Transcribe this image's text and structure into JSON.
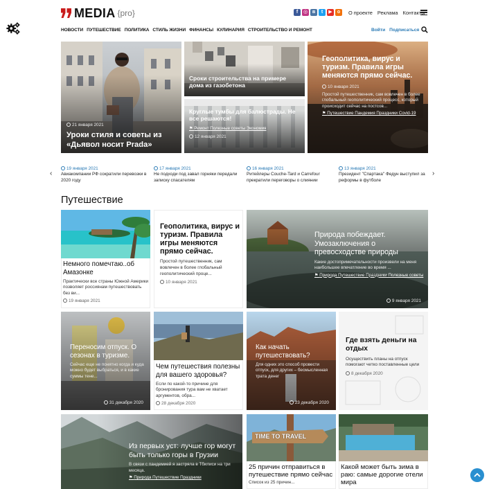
{
  "header": {
    "logo_text": "MEDIA",
    "logo_sub": "{pro}",
    "brand_color": "#c91c1c",
    "links": [
      "О проекте",
      "Реклама",
      "Контакты"
    ],
    "social": [
      {
        "icon": "facebook-icon",
        "glyph": "f",
        "color": "#3b5998"
      },
      {
        "icon": "instagram-icon",
        "glyph": "◎",
        "color": "#c13584"
      },
      {
        "icon": "vk-icon",
        "glyph": "в",
        "color": "#4c75a3"
      },
      {
        "icon": "twitter-icon",
        "glyph": "t",
        "color": "#1da1f2"
      },
      {
        "icon": "youtube-icon",
        "glyph": "▶",
        "color": "#e52d27"
      },
      {
        "icon": "odnoklassniki-icon",
        "glyph": "o",
        "color": "#f2720c"
      }
    ]
  },
  "nav": {
    "items": [
      "НОВОСТИ",
      "ПУТЕШЕСТВИЕ",
      "ПОЛИТИКА",
      "СТИЛЬ ЖИЗНИ",
      "ФИНАНСЫ",
      "КУЛИНАРИЯ",
      "СТРОИТЕЛЬСТВО И РЕМОНТ"
    ],
    "login": "Войти",
    "subscribe": "Подписаться"
  },
  "hero": {
    "main": {
      "date": "21 января 2021",
      "title": "Уроки стиля и советы из «Дьявол носит Prada»"
    },
    "mid_top": {
      "title": "Сроки строительства на примере дома из газобетона"
    },
    "mid_bottom": {
      "title": "Круглые тумбы для балюстрады. Не все решаются!",
      "tags": "Ремонт Полезные советы Экономия",
      "date": "12 января 2021"
    },
    "right": {
      "title": "Геополитика, вирус и туризм. Правила игры меняются прямо сейчас.",
      "date": "10 января 2021",
      "excerpt": "Простой путешественник, сам вовлечен в более глобальный геополитический процесс, который происходит сейчас на постсов...",
      "tags": "Путешествие Пандемия Праздники Covid-19"
    }
  },
  "ticker": [
    {
      "date": "19 января 2021",
      "text": "Авиакомпании РФ сократили перевозки в 2020 году"
    },
    {
      "date": "17 января 2021",
      "text": "Не подходи под завал горняки передали записку спасателям"
    },
    {
      "date": "16 января 2021",
      "text": "Ритейлеры Couche-Tard и Carrefour прекратили переговоры о слиянии"
    },
    {
      "date": "13 января 2021",
      "text": "Президент \"Спартака\" Федун выступил за реформы в футболе"
    }
  ],
  "section_title": "Путешествие",
  "cards": {
    "amazon": {
      "title": "Немного помечтаю..об Амазонке",
      "excerpt": "Практически все страны Южной Америки позволяет россиянам путешествовать без ви...",
      "date": "19 января 2021"
    },
    "geo": {
      "title": "Геополитика, вирус и туризм. Правила игры меняются прямо сейчас.",
      "excerpt": "Простой путешественник, сам вовлечен в более глобальный геополитический проце...",
      "date": "10 января 2021"
    },
    "nature": {
      "title": "Природа побеждает. Умозаключения о превосходстве природы",
      "excerpt": "Какие достопримечательности произвели на меня наибольшее впечатление во время ...",
      "tags": "Природа Путешествие Праздники Полезные советы",
      "date": "9 января 2021"
    },
    "vacation": {
      "title": "Переносим отпуск. О сезонах в туризме.",
      "excerpt": "Сейчас еще не понятно когда и куда можно будет выбраться, и в какие суммы тене...",
      "date": "31 декабря 2020"
    },
    "health": {
      "title": "Чем путешествия полезны для вашего здоровья?",
      "excerpt": "Если по какой-то причине для бронирования тура вам не хватает аргументов, обра...",
      "date": "28 декабря 2020"
    },
    "traveler": {
      "title": "Как начать путешествовать?",
      "excerpt": "Для одних это способ провести отпуск, для других – бесмысленная трата денег",
      "date": "23 декабря 2020"
    },
    "money": {
      "title": "Где взять деньги на отдых",
      "excerpt": "Осуществить планы на отпуск помогают четко поставленные цели",
      "date": "8 декабря 2020"
    },
    "georgia": {
      "title": "Из первых уст: лучше гор могут быть только горы в Грузии",
      "excerpt": "В связи с пандемией я застряла в Тбилиси на три месяца.",
      "tags": "Природа Путешествие Праздники"
    },
    "reasons": {
      "title": "25 причин отправиться в путешествие прямо сейчас",
      "excerpt": "Список из 25 причин...",
      "sign": "TIME TO TRAVEL"
    },
    "winter": {
      "title": "Какой может быть зима в раю: самые дорогие отели мира"
    }
  }
}
